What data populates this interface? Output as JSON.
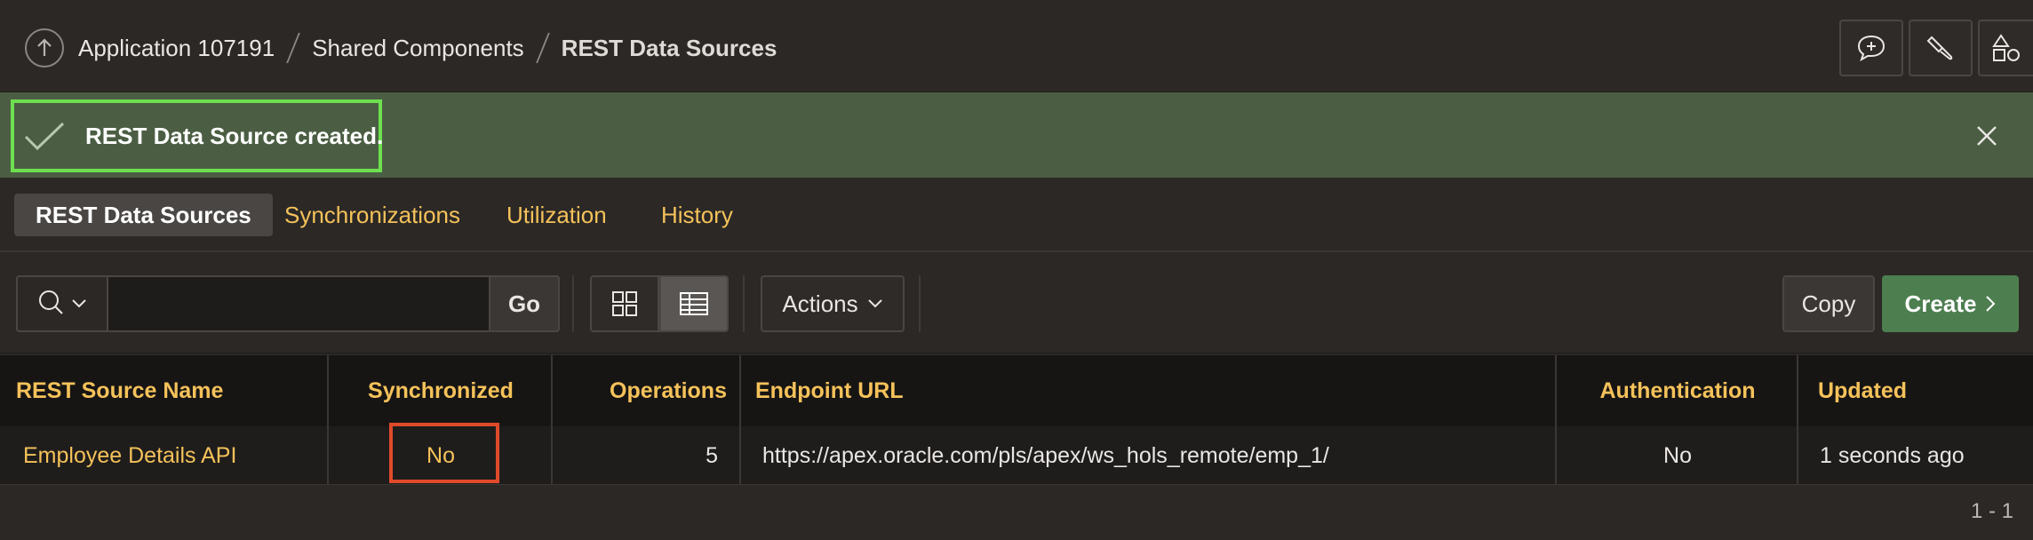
{
  "breadcrumb": {
    "items": [
      "Application 107191",
      "Shared Components",
      "REST Data Sources"
    ]
  },
  "toolbar_icons": [
    "comment-add-icon",
    "brush-icon",
    "shapes-icon"
  ],
  "alert": {
    "message": "REST Data Source created.",
    "status_color": "#4b5e43"
  },
  "tabs": [
    {
      "label": "REST Data Sources",
      "active": true
    },
    {
      "label": "Synchronizations",
      "active": false
    },
    {
      "label": "Utilization",
      "active": false
    },
    {
      "label": "History",
      "active": false
    }
  ],
  "search": {
    "placeholder": "",
    "value": "",
    "go_label": "Go"
  },
  "actions_label": "Actions",
  "copy_label": "Copy",
  "create_label": "Create",
  "table": {
    "columns": [
      "REST Source Name",
      "Synchronized",
      "Operations",
      "Endpoint URL",
      "Authentication",
      "Updated"
    ],
    "rows": [
      {
        "name": "Employee Details API",
        "synchronized": "No",
        "operations": "5",
        "endpoint": "https://apex.oracle.com/pls/apex/ws_hols_remote/emp_1/",
        "authentication": "No",
        "updated": "1 seconds ago"
      }
    ]
  },
  "pagination": "1 - 1",
  "colors": {
    "accent": "#f5c25a",
    "create_button": "#4d7e4f",
    "highlight": "#e04a2a",
    "alert_border": "#6ee04f"
  }
}
